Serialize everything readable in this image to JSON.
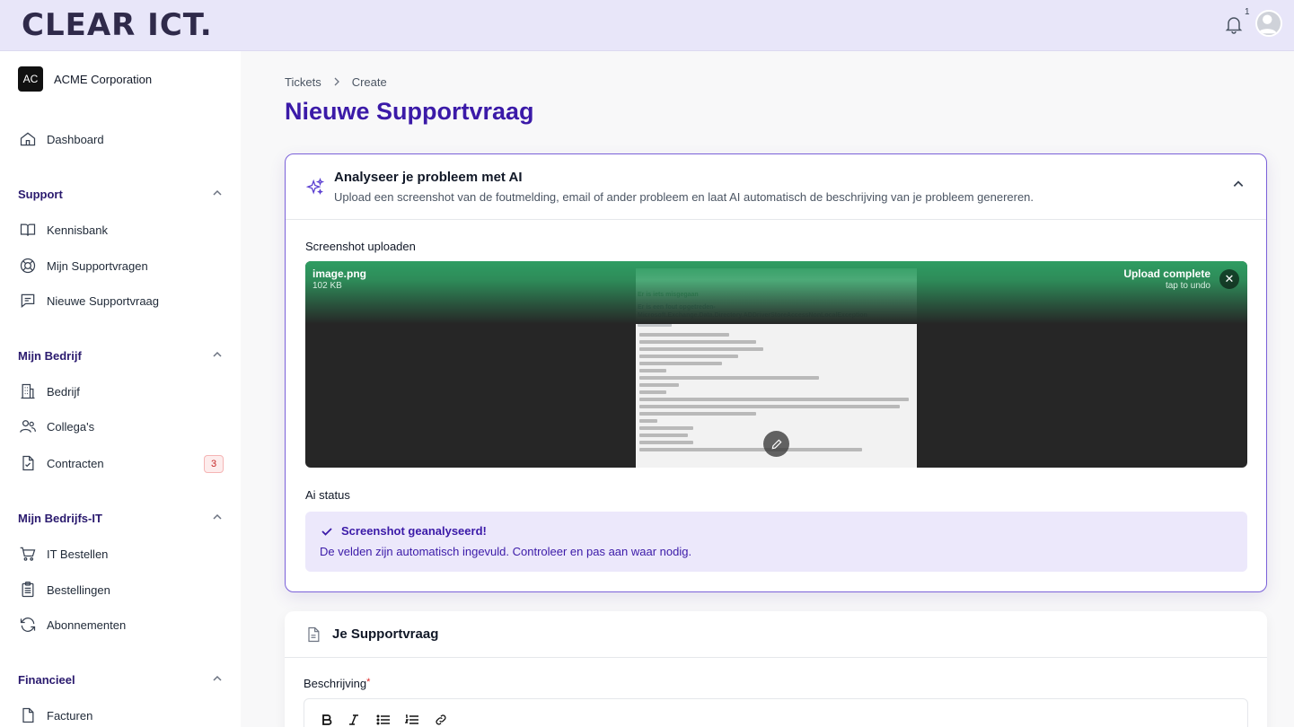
{
  "brand": {
    "logo_text": "CLEAR ICT."
  },
  "header": {
    "notification_count": "1"
  },
  "sidebar": {
    "org_initials": "AC",
    "org_name": "ACME Corporation",
    "dashboard": "Dashboard",
    "sections": {
      "support": "Support",
      "bedrijf": "Mijn Bedrijf",
      "bedrijfs_it": "Mijn Bedrijfs-IT",
      "financieel": "Financieel"
    },
    "items": {
      "kennisbank": "Kennisbank",
      "mijn_supportvragen": "Mijn Supportvragen",
      "nieuwe_supportvraag": "Nieuwe Supportvraag",
      "bedrijf": "Bedrijf",
      "collegas": "Collega's",
      "contracten": "Contracten",
      "contracten_badge": "3",
      "it_bestellen": "IT Bestellen",
      "bestellingen": "Bestellingen",
      "abonnementen": "Abonnementen",
      "facturen": "Facturen"
    }
  },
  "breadcrumb": {
    "tickets": "Tickets",
    "create": "Create"
  },
  "page": {
    "title": "Nieuwe Supportvraag"
  },
  "ai_card": {
    "title": "Analyseer je probleem met AI",
    "subtitle": "Upload een screenshot van de foutmelding, email of ander probleem en laat AI automatisch de beschrijving van je probleem genereren.",
    "upload_label": "Screenshot uploaden",
    "file": {
      "name": "image.png",
      "size": "102 KB",
      "status": "Upload complete",
      "undo": "tap to undo"
    },
    "status_label": "Ai status",
    "alert_title": "Screenshot geanalyseerd!",
    "alert_text": "De velden zijn automatisch ingevuld. Controleer en pas aan waar nodig."
  },
  "support_card": {
    "title": "Je Supportvraag",
    "description_label": "Beschrijving",
    "required_mark": "*"
  }
}
